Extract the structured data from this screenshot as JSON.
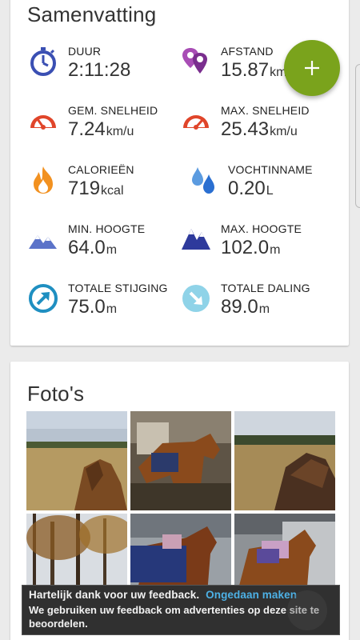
{
  "summary": {
    "title": "Samenvatting",
    "stats": [
      {
        "label": "DUUR",
        "value": "2:11:28",
        "unit": "",
        "icon": "stopwatch-icon"
      },
      {
        "label": "AFSTAND",
        "value": "15.87",
        "unit": "km",
        "icon": "location-pins-icon"
      },
      {
        "label": "GEM. SNELHEID",
        "value": "7.24",
        "unit": "km/u",
        "icon": "speedometer-icon"
      },
      {
        "label": "MAX. SNELHEID",
        "value": "25.43",
        "unit": "km/u",
        "icon": "speedometer-max-icon"
      },
      {
        "label": "CALORIEËN",
        "value": "719",
        "unit": "kcal",
        "icon": "flame-icon"
      },
      {
        "label": "VOCHTINNAME",
        "value": "0.20",
        "unit": "L",
        "icon": "water-drops-icon"
      },
      {
        "label": "MIN. HOOGTE",
        "value": "64.0",
        "unit": "m",
        "icon": "mountain-low-icon"
      },
      {
        "label": "MAX. HOOGTE",
        "value": "102.0",
        "unit": "m",
        "icon": "mountain-high-icon"
      },
      {
        "label": "TOTALE STIJGING",
        "value": "75.0",
        "unit": "m",
        "icon": "ascent-arrow-icon"
      },
      {
        "label": "TOTALE DALING",
        "value": "89.0",
        "unit": "m",
        "icon": "descent-arrow-icon"
      }
    ]
  },
  "fab": {
    "symbol": "+"
  },
  "photos": {
    "title": "Foto's",
    "items": [
      "landscape-horse-head",
      "saddled-horse-stable",
      "horse-closeup-field",
      "autumn-trees",
      "horse-blanket-stable",
      "horse-saddle-stable"
    ]
  },
  "snackbar": {
    "message": "Hartelijk dank voor uw feedback.",
    "action": "Ongedaan maken",
    "detail": "We gebruiken uw feedback om advertenties op deze site te beoordelen."
  },
  "colors": {
    "accent_green": "#7aa31c",
    "icon_blue": "#3a4fb3",
    "icon_red": "#e0452a",
    "icon_orange": "#f29120",
    "icon_purple": "#8a3d9e",
    "icon_teal": "#1f8fc1",
    "action_blue": "#4db1e6"
  }
}
